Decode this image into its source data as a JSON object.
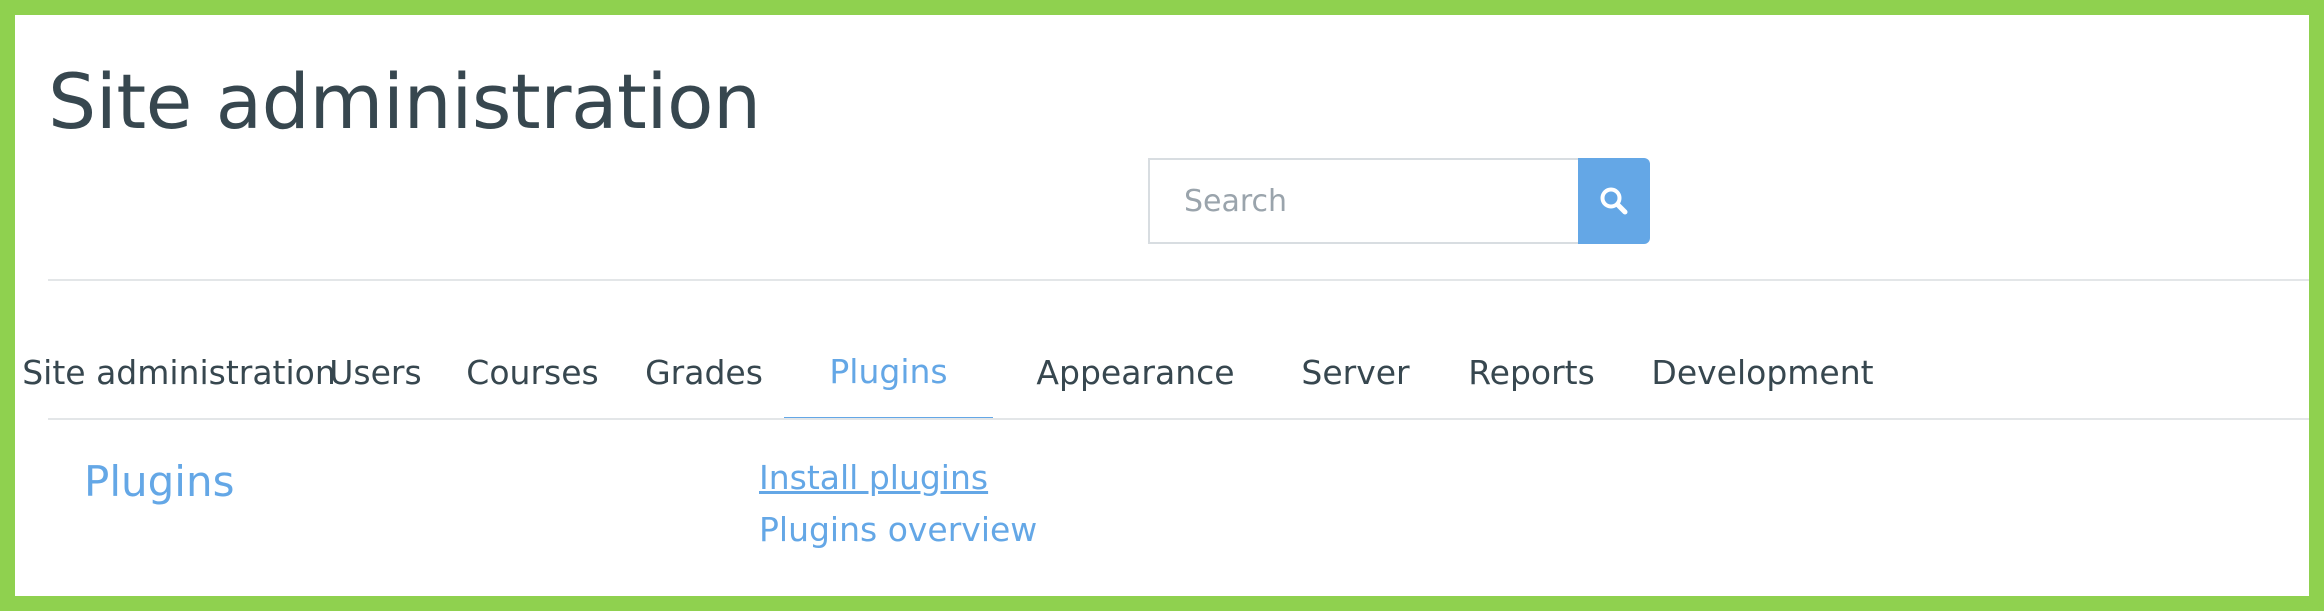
{
  "page": {
    "title": "Site administration"
  },
  "search": {
    "placeholder": "Search",
    "value": "",
    "icon": "search-icon"
  },
  "colors": {
    "accent": "#64a7e6",
    "text": "#37474f",
    "frame": "#8fd14f"
  },
  "tabs": [
    {
      "label": "Site administration",
      "active": false
    },
    {
      "label": "Users",
      "active": false
    },
    {
      "label": "Courses",
      "active": false
    },
    {
      "label": "Grades",
      "active": false
    },
    {
      "label": "Plugins",
      "active": true
    },
    {
      "label": "Appearance",
      "active": false
    },
    {
      "label": "Server",
      "active": false
    },
    {
      "label": "Reports",
      "active": false
    },
    {
      "label": "Development",
      "active": false
    }
  ],
  "section": {
    "heading": "Plugins",
    "links": [
      {
        "label": "Install plugins"
      },
      {
        "label": "Plugins overview"
      }
    ]
  }
}
